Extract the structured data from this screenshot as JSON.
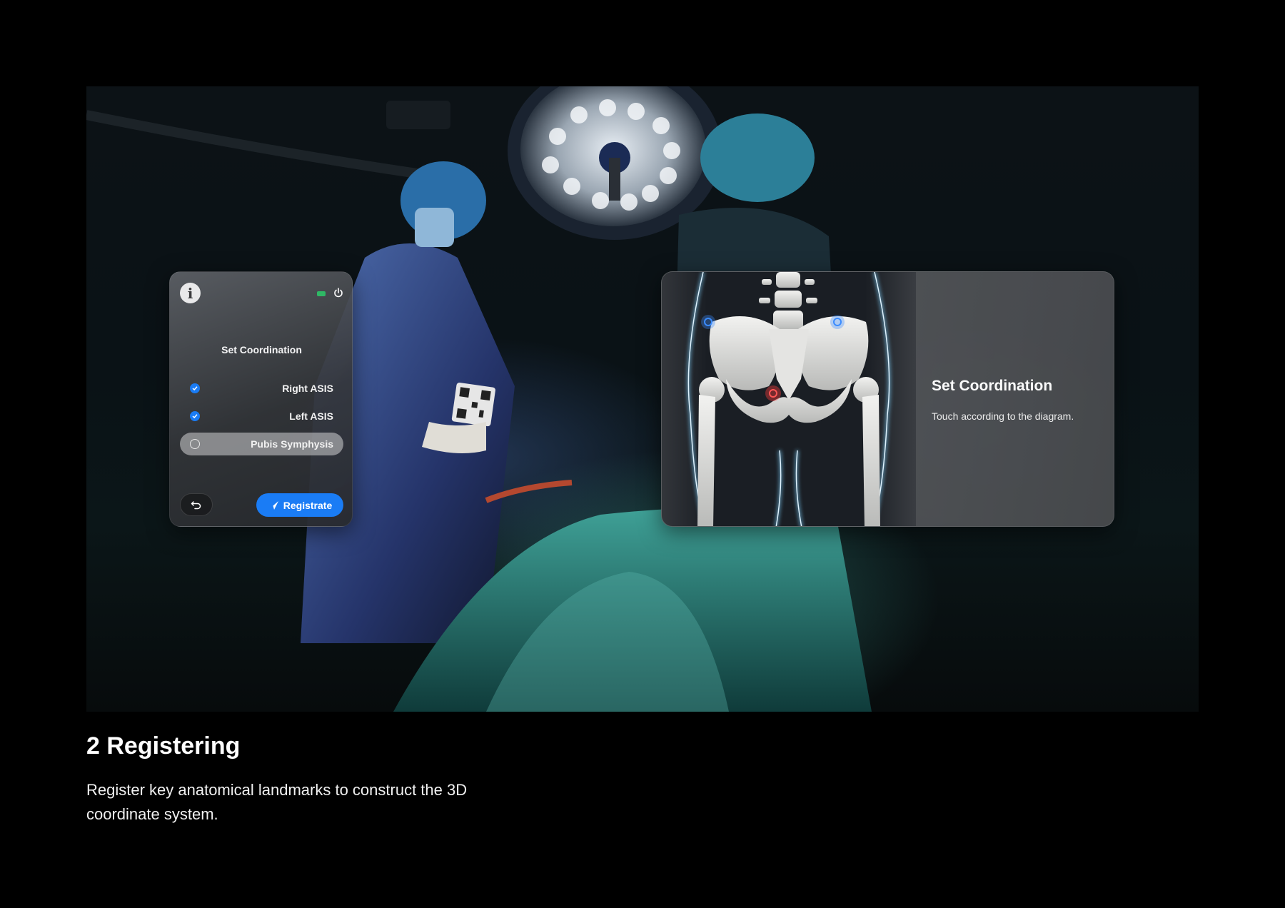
{
  "left_panel": {
    "title": "Set Coordination",
    "items": [
      {
        "label": "Right ASIS",
        "checked": true
      },
      {
        "label": "Left ASIS",
        "checked": true
      },
      {
        "label": "Pubis Symphysis",
        "checked": false,
        "active": true
      }
    ],
    "register_label": "Registrate",
    "icons": {
      "info": "info-icon",
      "battery": "battery-icon",
      "power": "power-icon",
      "back": "undo-icon",
      "register": "navigation-arrow-icon"
    },
    "colors": {
      "accent": "#1a7cf5",
      "battery": "#2fb865"
    }
  },
  "right_panel": {
    "title": "Set Coordination",
    "subtitle": "Touch according to the diagram.",
    "landmark_colors": {
      "done": "#3b8cff",
      "pending": "#ff3b3b"
    }
  },
  "caption": {
    "title": "2 Registering",
    "body": "Register key anatomical landmarks to construct the 3D coordinate system."
  }
}
